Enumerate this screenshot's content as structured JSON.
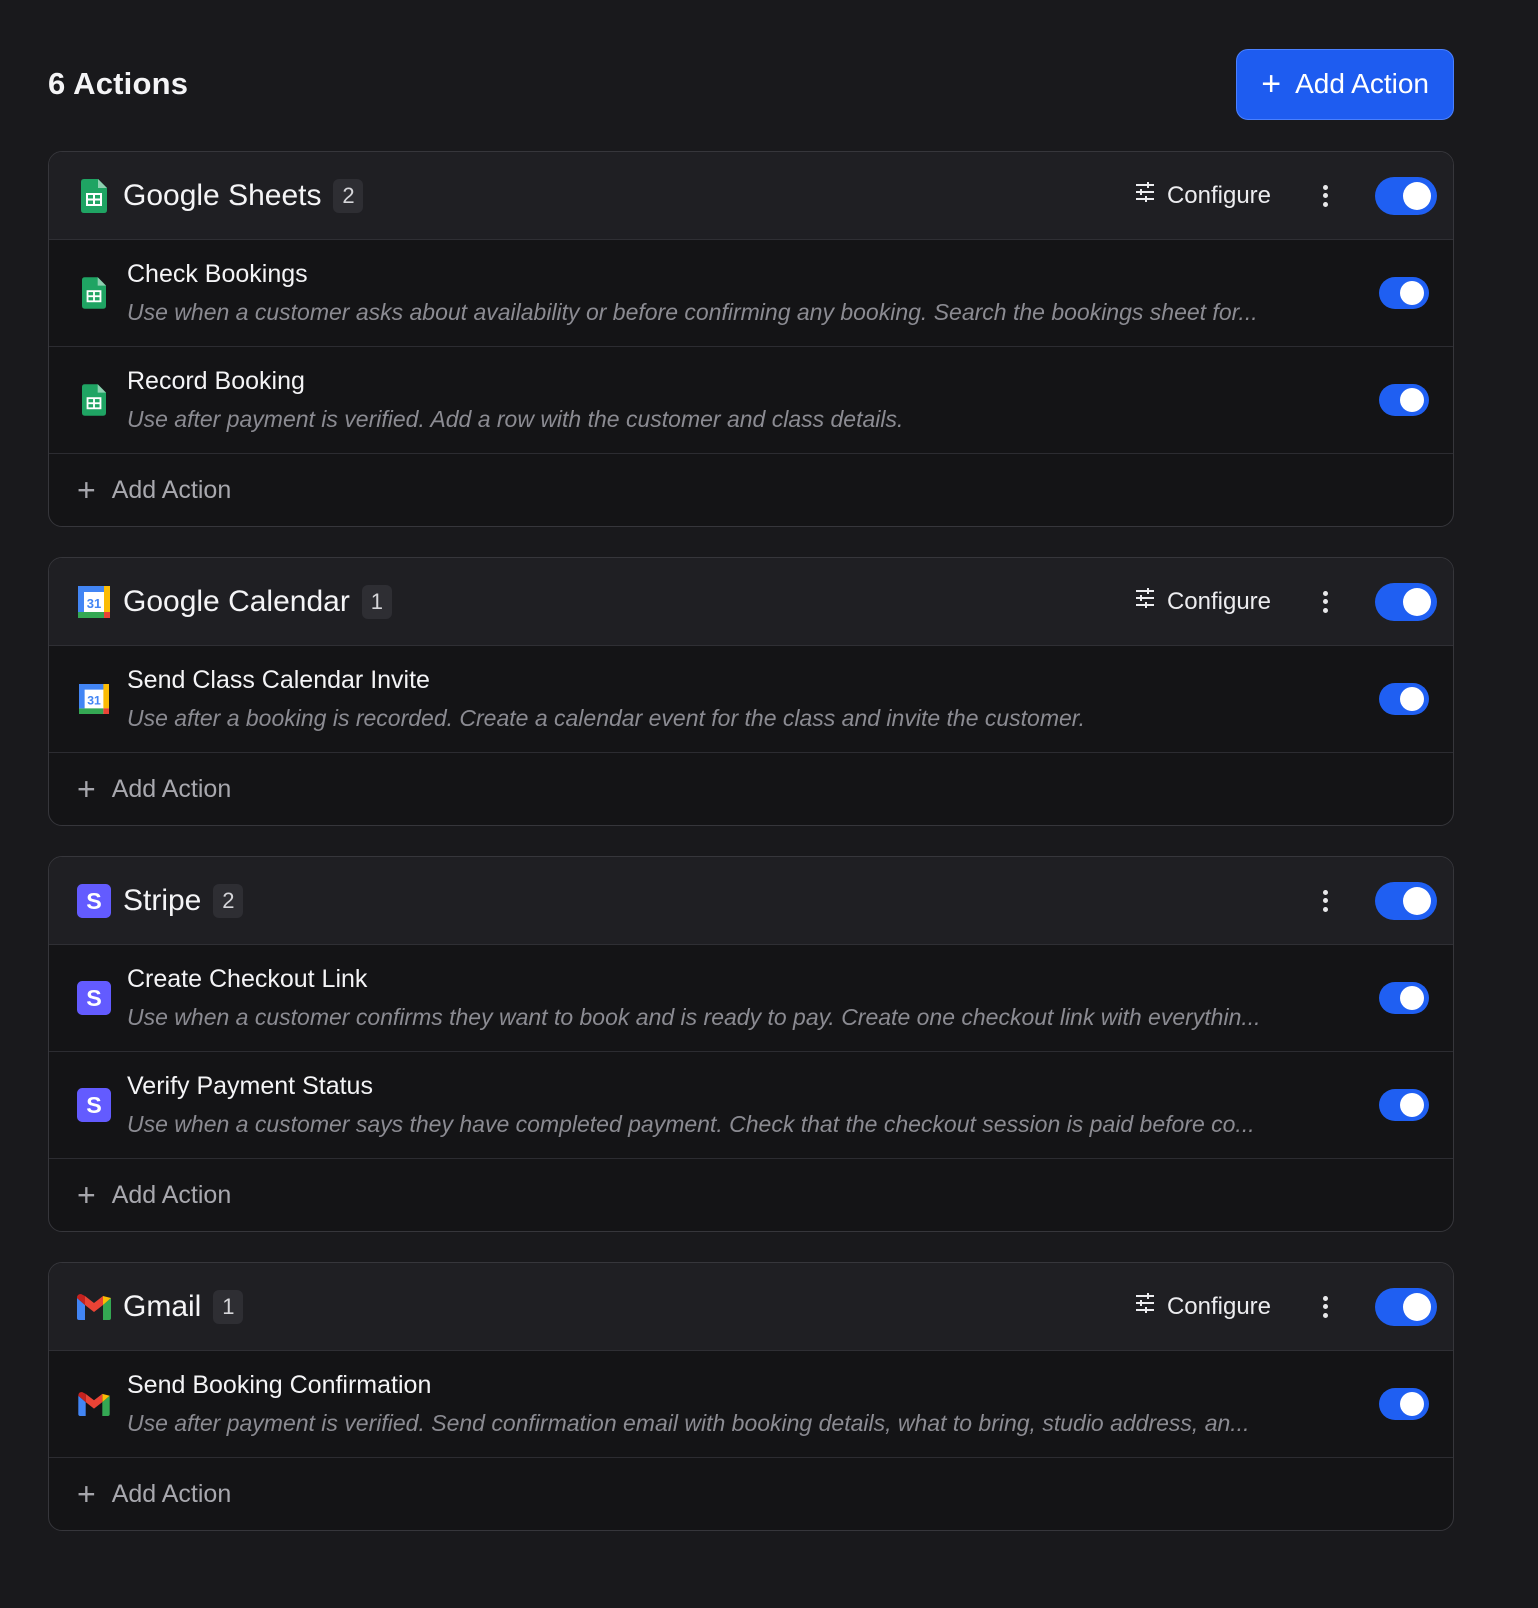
{
  "header": {
    "title": "6 Actions",
    "add_button_label": "Add Action"
  },
  "colors": {
    "accent": "#1e5cf0",
    "toggle_on": "#1f5ff2",
    "background": "#19191c"
  },
  "groups": [
    {
      "name": "Google Sheets",
      "icon": "google-sheets-icon",
      "count": "2",
      "configure_label": "Configure",
      "enabled": true,
      "actions": [
        {
          "title": "Check Bookings",
          "description": "Use when a customer asks about availability or before confirming any booking. Search the bookings sheet for...",
          "enabled": true
        },
        {
          "title": "Record Booking",
          "description": "Use after payment is verified. Add a row with the customer and class details.",
          "enabled": true
        }
      ],
      "add_action_label": "Add Action"
    },
    {
      "name": "Google Calendar",
      "icon": "google-calendar-icon",
      "count": "1",
      "configure_label": "Configure",
      "enabled": true,
      "actions": [
        {
          "title": "Send Class Calendar Invite",
          "description": "Use after a booking is recorded. Create a calendar event for the class and invite the customer.",
          "enabled": true
        }
      ],
      "add_action_label": "Add Action"
    },
    {
      "name": "Stripe",
      "icon": "stripe-icon",
      "count": "2",
      "configure_label": "",
      "enabled": true,
      "actions": [
        {
          "title": "Create Checkout Link",
          "description": "Use when a customer confirms they want to book and is ready to pay. Create one checkout link with everythin...",
          "enabled": true
        },
        {
          "title": "Verify Payment Status",
          "description": "Use when a customer says they have completed payment. Check that the checkout session is paid before co...",
          "enabled": true
        }
      ],
      "add_action_label": "Add Action"
    },
    {
      "name": "Gmail",
      "icon": "gmail-icon",
      "count": "1",
      "configure_label": "Configure",
      "enabled": true,
      "actions": [
        {
          "title": "Send Booking Confirmation",
          "description": "Use after payment is verified. Send confirmation email with booking details, what to bring, studio address, an...",
          "enabled": true
        }
      ],
      "add_action_label": "Add Action"
    }
  ]
}
